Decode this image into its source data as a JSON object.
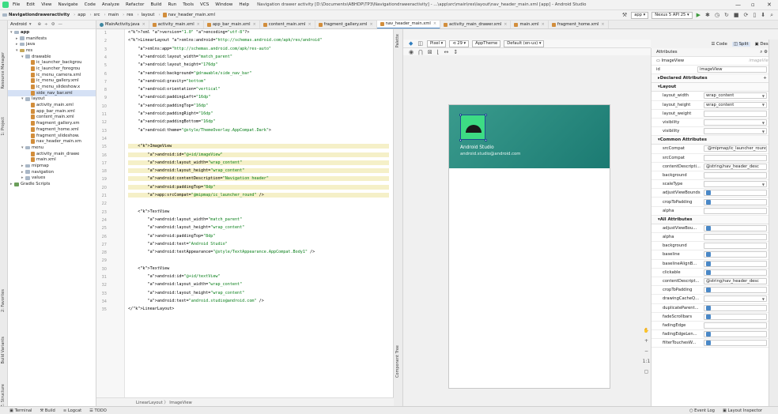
{
  "app": {
    "menu": [
      "File",
      "Edit",
      "View",
      "Navigate",
      "Code",
      "Analyze",
      "Refactor",
      "Build",
      "Run",
      "Tools",
      "VCS",
      "Window",
      "Help"
    ],
    "window_title": "Navigation drawer activity [D:\\Documents\\ABHDP\\TP3\\Navigationdraweractivity] - ...\\app\\src\\main\\res\\layout\\nav_header_main.xml [app] - Android Studio"
  },
  "breadcrumb": [
    "Navigationdraweractivity",
    "app",
    "src",
    "main",
    "res",
    "layout",
    "nav_header_main.xml"
  ],
  "toolbar": {
    "run_config": "app",
    "device": "Nexus 5 API 25"
  },
  "project": {
    "header": "Android",
    "items": [
      {
        "label": "app",
        "depth": 0,
        "kind": "folder",
        "open": true
      },
      {
        "label": "manifests",
        "depth": 1,
        "kind": "folder",
        "open": false
      },
      {
        "label": "java",
        "depth": 1,
        "kind": "folder",
        "open": false
      },
      {
        "label": "res",
        "depth": 1,
        "kind": "res",
        "open": true
      },
      {
        "label": "drawable",
        "depth": 2,
        "kind": "folder",
        "open": true
      },
      {
        "label": "ic_launcher_backgrou",
        "depth": 3,
        "kind": "xml"
      },
      {
        "label": "ic_launcher_foregrou",
        "depth": 3,
        "kind": "xml"
      },
      {
        "label": "ic_menu_camera.xml",
        "depth": 3,
        "kind": "xml"
      },
      {
        "label": "ic_menu_gallery.xml",
        "depth": 3,
        "kind": "xml"
      },
      {
        "label": "ic_menu_slideshow.x",
        "depth": 3,
        "kind": "xml"
      },
      {
        "label": "side_nav_bar.xml",
        "depth": 3,
        "kind": "xml",
        "selected": true
      },
      {
        "label": "layout",
        "depth": 2,
        "kind": "folder",
        "open": true
      },
      {
        "label": "activity_main.xml",
        "depth": 3,
        "kind": "xml"
      },
      {
        "label": "app_bar_main.xml",
        "depth": 3,
        "kind": "xml"
      },
      {
        "label": "content_main.xml",
        "depth": 3,
        "kind": "xml"
      },
      {
        "label": "fragment_gallery.xm",
        "depth": 3,
        "kind": "xml"
      },
      {
        "label": "fragment_home.xml",
        "depth": 3,
        "kind": "xml"
      },
      {
        "label": "fragment_slideshow.",
        "depth": 3,
        "kind": "xml"
      },
      {
        "label": "nav_header_main.xm",
        "depth": 3,
        "kind": "xml"
      },
      {
        "label": "menu",
        "depth": 2,
        "kind": "folder",
        "open": true
      },
      {
        "label": "activity_main_drawe",
        "depth": 3,
        "kind": "xml"
      },
      {
        "label": "main.xml",
        "depth": 3,
        "kind": "xml"
      },
      {
        "label": "mipmap",
        "depth": 2,
        "kind": "folder",
        "open": false
      },
      {
        "label": "navigation",
        "depth": 2,
        "kind": "folder",
        "open": false
      },
      {
        "label": "values",
        "depth": 2,
        "kind": "folder",
        "open": false
      },
      {
        "label": "Gradle Scripts",
        "depth": 0,
        "kind": "gradle",
        "open": false
      }
    ]
  },
  "tabs": [
    {
      "label": "MainActivity.java",
      "kind": "java"
    },
    {
      "label": "activity_main.xml",
      "kind": "xml"
    },
    {
      "label": "app_bar_main.xml",
      "kind": "xml"
    },
    {
      "label": "content_main.xml",
      "kind": "xml"
    },
    {
      "label": "fragment_gallery.xml",
      "kind": "xml"
    },
    {
      "label": "nav_header_main.xml",
      "kind": "xml",
      "active": true
    },
    {
      "label": "activity_main_drawer.xml",
      "kind": "xml"
    },
    {
      "label": "main.xml",
      "kind": "xml"
    },
    {
      "label": "fragment_home.xml",
      "kind": "xml"
    }
  ],
  "code_lines": [
    "<?xml version=\"1.0\" encoding=\"utf-8\"?>",
    "<LinearLayout xmlns:android=\"http://schemas.android.com/apk/res/android\"",
    "    xmlns:app=\"http://schemas.android.com/apk/res-auto\"",
    "    android:layout_width=\"match_parent\"",
    "    android:layout_height=\"176dp\"",
    "    android:background=\"@drawable/side_nav_bar\"",
    "    android:gravity=\"bottom\"",
    "    android:orientation=\"vertical\"",
    "    android:paddingLeft=\"16dp\"",
    "    android:paddingTop=\"16dp\"",
    "    android:paddingRight=\"16dp\"",
    "    android:paddingBottom=\"16dp\"",
    "    android:theme=\"@style/ThemeOverlay.AppCompat.Dark\">",
    "",
    "    <ImageView",
    "        android:id=\"@+id/imageView\"",
    "        android:layout_width=\"wrap_content\"",
    "        android:layout_height=\"wrap_content\"",
    "        android:contentDescription=\"Navigation header\"",
    "        android:paddingTop=\"8dp\"",
    "        app:srcCompat=\"@mipmap/ic_launcher_round\" />",
    "",
    "    <TextView",
    "        android:layout_width=\"match_parent\"",
    "        android:layout_height=\"wrap_content\"",
    "        android:paddingTop=\"8dp\"",
    "        android:text=\"Android Studio\"",
    "        android:textAppearance=\"@style/TextAppearance.AppCompat.Body1\" />",
    "",
    "    <TextView",
    "        android:id=\"@+id/textView\"",
    "        android:layout_width=\"wrap_content\"",
    "        android:layout_height=\"wrap_content\"",
    "        android:text=\"android.studio@android.com\" />",
    "</LinearLayout>"
  ],
  "editor_breadcrumb": "LinearLayout  〉 ImageView",
  "design": {
    "modes": [
      "Code",
      "Split",
      "Design"
    ],
    "active_mode": "Split",
    "device_label": "Pixel",
    "api_label": "29",
    "theme_label": "AppTheme",
    "locale_label": "Default (en-us)",
    "header_title": "Android Studio",
    "header_subtitle": "android.studio@android.com",
    "colors": {
      "header_start": "#3a9b8d",
      "header_end": "#1b7a72",
      "accent": "#3ddc84"
    }
  },
  "attributes": {
    "title": "Attributes",
    "widget": "ImageView",
    "widget_hint": "imageView",
    "id_label": "id",
    "id_value": "imageView",
    "sections": [
      {
        "title": "Declared Attributes",
        "rows": []
      },
      {
        "title": "Layout",
        "rows": [
          {
            "label": "layout_width",
            "value": "wrap_content",
            "dd": true
          },
          {
            "label": "layout_height",
            "value": "wrap_content",
            "dd": true
          },
          {
            "label": "layout_weight",
            "value": ""
          },
          {
            "label": "visibility",
            "value": "",
            "dd": true
          },
          {
            "label": "visibility",
            "value": "",
            "dd": true
          }
        ]
      },
      {
        "title": "Common Attributes",
        "rows": [
          {
            "label": "srcCompat",
            "value": "@mipmap/ic_launcher_round"
          },
          {
            "label": "srcCompat",
            "value": ""
          },
          {
            "label": "contentDescripti...",
            "value": "@string/nav_header_desc"
          },
          {
            "label": "background",
            "value": ""
          },
          {
            "label": "scaleType",
            "value": "",
            "dd": true
          },
          {
            "label": "adjustViewBounds",
            "value": ""
          },
          {
            "label": "cropToPadding",
            "value": ""
          },
          {
            "label": "alpha",
            "value": ""
          }
        ]
      },
      {
        "title": "All Attributes",
        "rows": [
          {
            "label": "adjustViewBou...",
            "value": ""
          },
          {
            "label": "alpha",
            "value": ""
          },
          {
            "label": "background",
            "value": ""
          },
          {
            "label": "baseline",
            "value": ""
          },
          {
            "label": "baselineAlignB...",
            "value": ""
          },
          {
            "label": "clickable",
            "value": ""
          },
          {
            "label": "contentDescript...",
            "value": "@string/nav_header_desc"
          },
          {
            "label": "cropToPadding",
            "value": ""
          },
          {
            "label": "drawingCacheQ...",
            "value": "",
            "dd": true
          },
          {
            "label": "duplicateParent...",
            "value": ""
          },
          {
            "label": "fadeScrollbars",
            "value": ""
          },
          {
            "label": "fadingEdge",
            "value": ""
          },
          {
            "label": "fadingEdgeLen...",
            "value": ""
          },
          {
            "label": "filterTouchesW...",
            "value": ""
          }
        ]
      }
    ]
  },
  "statusbar": {
    "left": [
      "Terminal",
      "Build",
      "Logcat",
      "TODO"
    ],
    "right": [
      "Event Log",
      "Layout Inspector"
    ]
  },
  "side_tabs": {
    "left": [
      "Resource Manager",
      "1: Project",
      "2: Favorites",
      "Build Variants",
      "Z: Structure"
    ],
    "preview": "Palette",
    "canvas": "Component Tree"
  }
}
